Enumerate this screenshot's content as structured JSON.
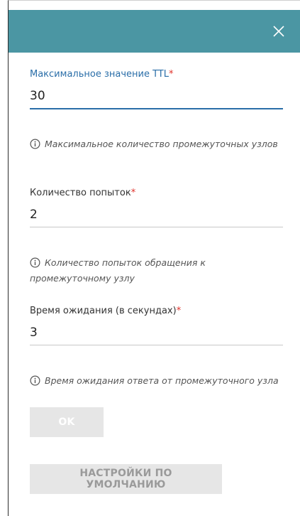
{
  "dialog": {
    "close_icon": "close-icon"
  },
  "fields": {
    "ttl": {
      "label": "Максимальное значение TTL",
      "required_mark": "*",
      "value": "30",
      "hint": "Максимальное количество промежуточных узлов"
    },
    "attempts": {
      "label": "Количество попыток",
      "required_mark": "*",
      "value": "2",
      "hint": "Количество попыток обращения к промежуточному узлу"
    },
    "timeout": {
      "label": "Время ожидания (в секундах)",
      "required_mark": "*",
      "value": "3",
      "hint": "Время ожидания ответа от промежуточного узла"
    }
  },
  "buttons": {
    "ok_label": "OK",
    "defaults_label": "НАСТРОЙКИ ПО УМОЛЧАНИЮ"
  },
  "colors": {
    "header": "#4b96a3",
    "active_accent": "#2a6ea8",
    "required": "#e0312a",
    "button_disabled": "#e6e6e6"
  }
}
